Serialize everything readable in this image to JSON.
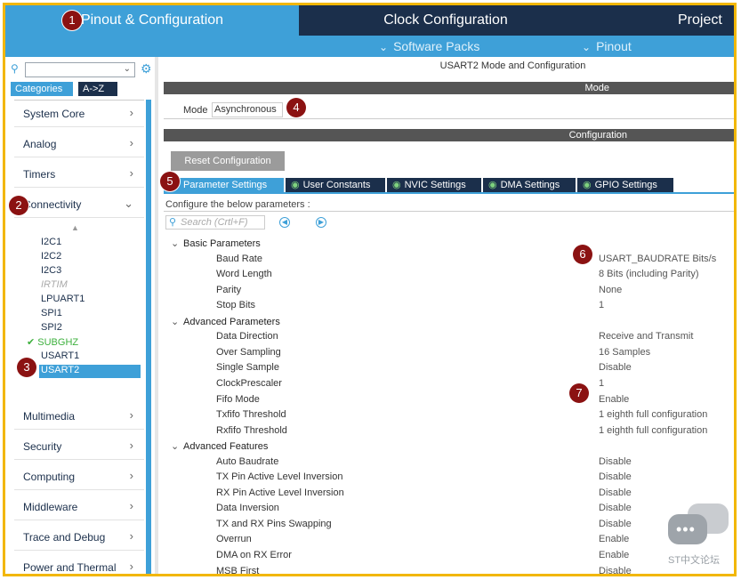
{
  "top_tabs": [
    {
      "label": "Pinout & Configuration"
    },
    {
      "label": "Clock Configuration"
    },
    {
      "label": "Project"
    }
  ],
  "sub_menu": {
    "software_packs": "Software Packs",
    "pinout": "Pinout"
  },
  "left": {
    "category_tabs": [
      "Categories",
      "A->Z"
    ],
    "categories_top": [
      "System Core",
      "Analog",
      "Timers",
      "Connectivity"
    ],
    "connectivity_items": [
      "I2C1",
      "I2C2",
      "I2C3",
      "IRTIM",
      "LPUART1",
      "SPI1",
      "SPI2",
      "SUBGHZ",
      "USART1",
      "USART2"
    ],
    "categories_bottom": [
      "Multimedia",
      "Security",
      "Computing",
      "Middleware",
      "Trace and Debug",
      "Power and Thermal"
    ]
  },
  "right": {
    "header": "USART2 Mode and Configuration",
    "mode_bar": "Mode",
    "mode_label": "Mode",
    "mode_value": "Asynchronous",
    "config_bar": "Configuration",
    "reset_button": "Reset Configuration",
    "param_tabs": [
      "Parameter Settings",
      "User Constants",
      "NVIC Settings",
      "DMA Settings",
      "GPIO Settings"
    ],
    "configure_text": "Configure the below parameters :",
    "search_placeholder": "Search (Crtl+F)",
    "groups": [
      {
        "name": "Basic Parameters",
        "params": [
          {
            "name": "Baud Rate",
            "value": "USART_BAUDRATE Bits/s"
          },
          {
            "name": "Word Length",
            "value": "8 Bits (including Parity)"
          },
          {
            "name": "Parity",
            "value": "None"
          },
          {
            "name": "Stop Bits",
            "value": "1"
          }
        ]
      },
      {
        "name": "Advanced Parameters",
        "params": [
          {
            "name": "Data Direction",
            "value": "Receive and Transmit"
          },
          {
            "name": "Over Sampling",
            "value": "16 Samples"
          },
          {
            "name": "Single Sample",
            "value": "Disable"
          },
          {
            "name": "ClockPrescaler",
            "value": "1"
          },
          {
            "name": "Fifo Mode",
            "value": "Enable"
          },
          {
            "name": "Txfifo Threshold",
            "value": "1 eighth full configuration"
          },
          {
            "name": "Rxfifo Threshold",
            "value": "1 eighth full configuration"
          }
        ]
      },
      {
        "name": "Advanced Features",
        "params": [
          {
            "name": "Auto Baudrate",
            "value": "Disable"
          },
          {
            "name": "TX Pin Active Level Inversion",
            "value": "Disable"
          },
          {
            "name": "RX Pin Active Level Inversion",
            "value": "Disable"
          },
          {
            "name": "Data Inversion",
            "value": "Disable"
          },
          {
            "name": "TX and RX Pins Swapping",
            "value": "Disable"
          },
          {
            "name": "Overrun",
            "value": "Enable"
          },
          {
            "name": "DMA on RX Error",
            "value": "Enable"
          },
          {
            "name": "MSB First",
            "value": "Disable"
          }
        ]
      }
    ]
  },
  "markers": [
    "1",
    "2",
    "3",
    "4",
    "5",
    "6",
    "7"
  ],
  "watermark": "ST中文论坛",
  "colors": {
    "accent": "#3ea0d8",
    "dark": "#1b2f4b",
    "marker": "#8b1212",
    "frame": "#f2b705",
    "ok": "#3db03d"
  }
}
